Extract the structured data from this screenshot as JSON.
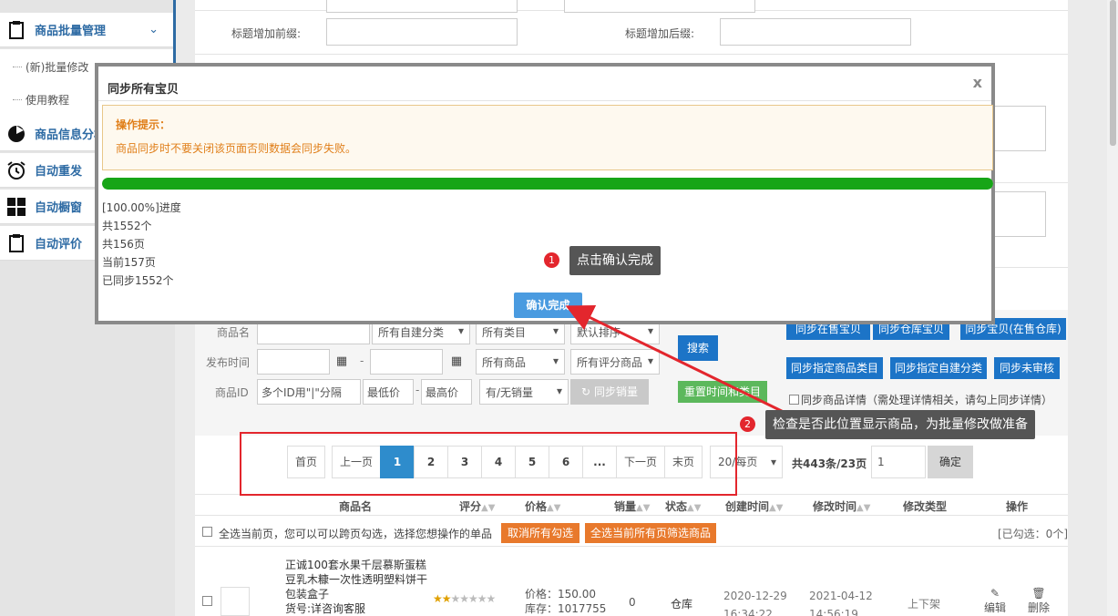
{
  "sidebar": {
    "items": [
      {
        "label": "商品批量管理",
        "icon": "clipboard-icon"
      },
      {
        "label": "商品信息分析",
        "icon": "pie-chart-icon"
      },
      {
        "label": "自动重发",
        "icon": "alarm-clock-icon"
      },
      {
        "label": "自动橱窗",
        "icon": "grid-icon"
      },
      {
        "label": "自动评价",
        "icon": "clipboard-icon"
      }
    ],
    "subitems": [
      "(新)批量修改",
      "使用教程"
    ]
  },
  "form": {
    "prefix_label": "标题增加前缀:",
    "suffix_label": "标题增加后缀:"
  },
  "filter": {
    "product_name_label": "商品名",
    "publish_time_label": "发布时间",
    "product_id_label": "商品ID",
    "category_select": "所有自建分类",
    "all_categories": "所有类目",
    "sort_select": "默认排序",
    "all_products": "所有商品",
    "all_rating": "所有评分商品",
    "sales_select": "有/无销量",
    "id_placeholder": "多个ID用\"|\"分隔",
    "min_price": "最低价",
    "max_price": "最高价",
    "date_sep": "-",
    "price_sep": "-",
    "search_btn": "搜索",
    "sync_sales_btn": "同步销量",
    "reset_btn": "重置时间和类目",
    "sync_onsale_btn": "同步在售宝贝",
    "sync_warehouse_btn": "同步仓库宝贝",
    "sync_all_btn": "同步宝贝(在售仓库)",
    "sync_category_btn": "同步指定商品类目",
    "sync_custom_btn": "同步指定自建分类",
    "sync_unreviewed_btn": "同步未审核",
    "sync_detail_text": "同步商品详情（需处理详情相关，请勾上同步详情）"
  },
  "pager": {
    "first": "首页",
    "prev": "上一页",
    "pages": [
      "1",
      "2",
      "3",
      "4",
      "5",
      "6",
      "..."
    ],
    "next": "下一页",
    "last": "末页",
    "per_page": "20/每页",
    "total": "共443条/23页",
    "page_input": "1",
    "go": "确定"
  },
  "table": {
    "headers": [
      "商品名",
      "评分",
      "价格",
      "销量",
      "状态",
      "创建时间",
      "修改时间",
      "修改类型",
      "操作"
    ],
    "select_all_text": "全选当前页，您可以可以跨页勾选，选择您想操作的单品",
    "cancel_all_btn": "取消所有勾选",
    "select_filter_btn": "全选当前所有页筛选商品",
    "selected_info": "[已勾选：0个]",
    "row": {
      "name_lines": [
        "正诚100套水果千层慕斯蛋糕",
        "豆乳木糠一次性透明塑料饼干",
        "包装盒子",
        "货号:详咨询客服"
      ],
      "rating": 2,
      "rating_max": 7,
      "price": "价格：150.00",
      "stock": "库存：1017755",
      "sales": "0",
      "status": "仓库",
      "created_date": "2020-12-29",
      "created_time": "16:34:22",
      "modified_date": "2021-04-12",
      "modified_time": "14:56:19",
      "modify_type": "上下架",
      "edit": "编辑",
      "delete": "删除"
    }
  },
  "modal": {
    "title": "同步所有宝贝",
    "close": "x",
    "tip_title": "操作提示：",
    "tip_body": "商品同步时不要关闭该页面否则数据会同步失败。",
    "progress_fraction": 1.0,
    "lines": [
      "[100.00%]进度",
      "共1552个",
      "共156页",
      "当前157页",
      "已同步1552个"
    ],
    "confirm": "确认完成"
  },
  "annotations": {
    "one_num": "1",
    "one_text": "点击确认完成",
    "two_num": "2",
    "two_text": "检查是否此位置显示商品，为批量修改做准备"
  },
  "colors": {
    "accent_blue": "#1c74c7",
    "progress_green": "#17a517",
    "tip_orange": "#e07f1a",
    "annotation_red": "#e3262d"
  }
}
